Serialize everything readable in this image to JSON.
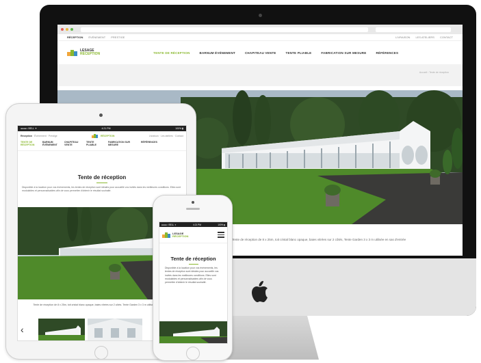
{
  "desktop": {
    "nav_left": [
      "RÉCEPTION",
      "ÉVÉNEMENT",
      "PRESTIGE"
    ],
    "nav_right": [
      "LIVRAISON",
      "LES ATELIERS",
      "CONTACT"
    ],
    "logo_line1": "LESAGE",
    "logo_line2": "RÉCEPTION",
    "menu": [
      "TENTE DE RÉCEPTION",
      "BARNUM ÉVÉNEMENT",
      "CHAPITEAU VENTE",
      "TENTE PLIABLE",
      "FABRICATION SUR MESURE",
      "RÉFÉRENCES"
    ],
    "breadcrumb": "Accueil › Tente de réception",
    "caption": "Tente de réception de 8 x 25m, toit cristal blanc opaque, baies vitrées sur 2 côtés, Tente Garden 3 x 3 m utilisée en sas d'entrée"
  },
  "tablet": {
    "status_left": "●●●●○ BELL ✦",
    "status_time": "4:21 PM",
    "status_right": "100% ▮",
    "top_links": [
      "Réception",
      "Événement",
      "Prestige"
    ],
    "top_right": [
      "Livraison",
      "Les ateliers",
      "Contact"
    ],
    "tabs": [
      "TENTE DE RÉCEPTION",
      "BARNUM ÉVÉNEMENT",
      "CHAPITEAU VENTE",
      "TENTE PLIABLE",
      "FABRICATION SUR MESURE",
      "RÉFÉRENCES"
    ],
    "title": "Tente de réception",
    "body": "Disponible à la location pour vos événements, les tentes de réception sont idéales pour accueillir vos invités dans les meilleures conditions. Elles sont modulables et personnalisables afin de vous permettre d'obtenir le résultat souhaité.",
    "caption": "Tente de réception de 8 x 25m, toit cristal blanc opaque, baies vitrées sur 2 côtés. Tente Garden 3 x 3 m utilisée en sas d'entrée",
    "back_arrow": "‹"
  },
  "phone": {
    "status_left": "●●●●○ BELL ✦",
    "status_time": "4:21 PM",
    "status_right": "100% ▮",
    "logo_line1": "LESAGE",
    "logo_line2": "RÉCEPTION",
    "title": "Tente de réception",
    "body": "Disponible à la location pour vos événements, les tentes de réception sont idéales pour accueillir vos invités dans les meilleures conditions. Elles sont modulables et personnalisables afin de vous permettre d'obtenir le résultat souhaité."
  },
  "colors": {
    "accent": "#8ab82f",
    "bezel": "#111111",
    "grass": "#4f8a2a"
  }
}
